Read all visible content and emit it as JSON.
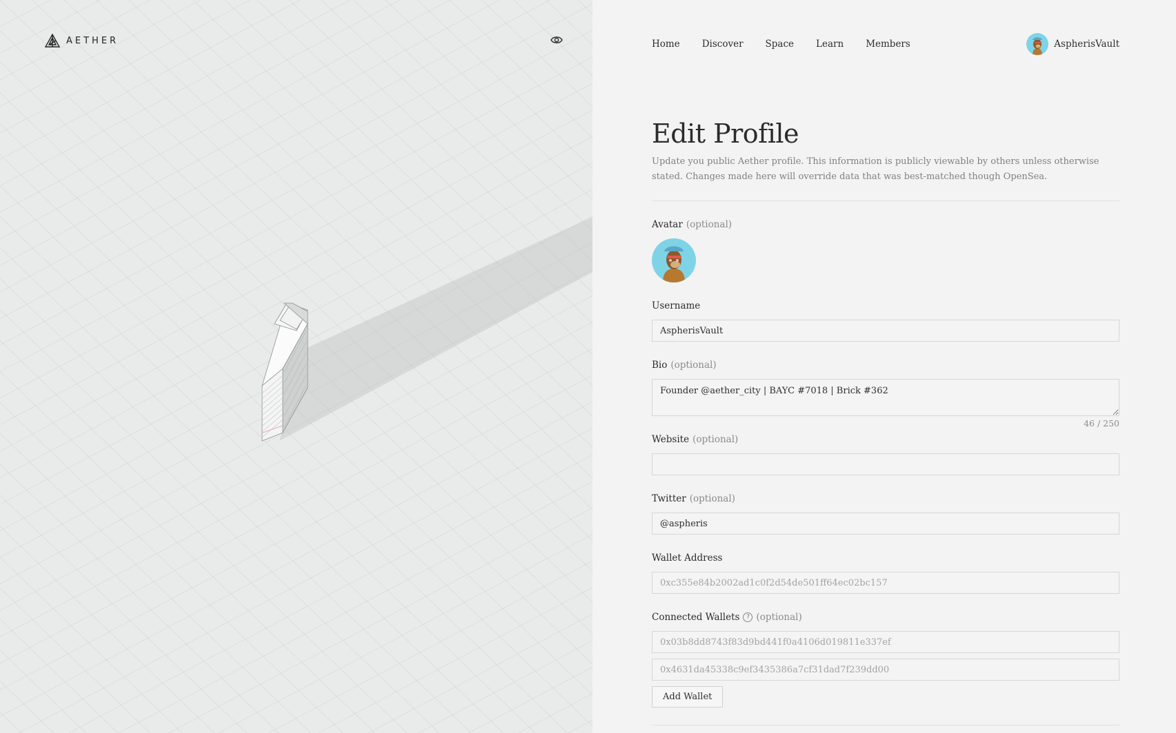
{
  "brand": {
    "name": "AETHER"
  },
  "nav": {
    "items": [
      {
        "label": "Home"
      },
      {
        "label": "Discover"
      },
      {
        "label": "Space"
      },
      {
        "label": "Learn"
      },
      {
        "label": "Members"
      }
    ],
    "user": {
      "name": "AspherisVault",
      "avatar_icon": "ape-avatar-icon"
    }
  },
  "page": {
    "title": "Edit Profile",
    "description": "Update you public Aether profile. This information is publicly viewable by others unless otherwise stated. Changes made here will override data that was best-matched though OpenSea."
  },
  "form": {
    "optional_tag": "(optional)",
    "avatar": {
      "label": "Avatar"
    },
    "username": {
      "label": "Username",
      "value": "AspherisVault"
    },
    "bio": {
      "label": "Bio",
      "value": "Founder @aether_city | BAYC #7018 | Brick #362",
      "counter": "46 / 250"
    },
    "website": {
      "label": "Website",
      "value": ""
    },
    "twitter": {
      "label": "Twitter",
      "value": "@aspheris"
    },
    "wallet": {
      "label": "Wallet Address",
      "value": "0xc355e84b2002ad1c0f2d54de501ff64ec02bc157"
    },
    "connected": {
      "label": "Connected Wallets",
      "wallets": [
        "0x03b8dd8743f83d9bd441f0a4106d019811e337ef",
        "0x4631da45338c9ef3435386a7cf31dad7f239dd00"
      ],
      "add_label": "Add Wallet"
    }
  },
  "colors": {
    "left_bg": "#e9eaea",
    "right_bg": "#f3f3f3",
    "avatar_bg": "#7ed4e6"
  }
}
